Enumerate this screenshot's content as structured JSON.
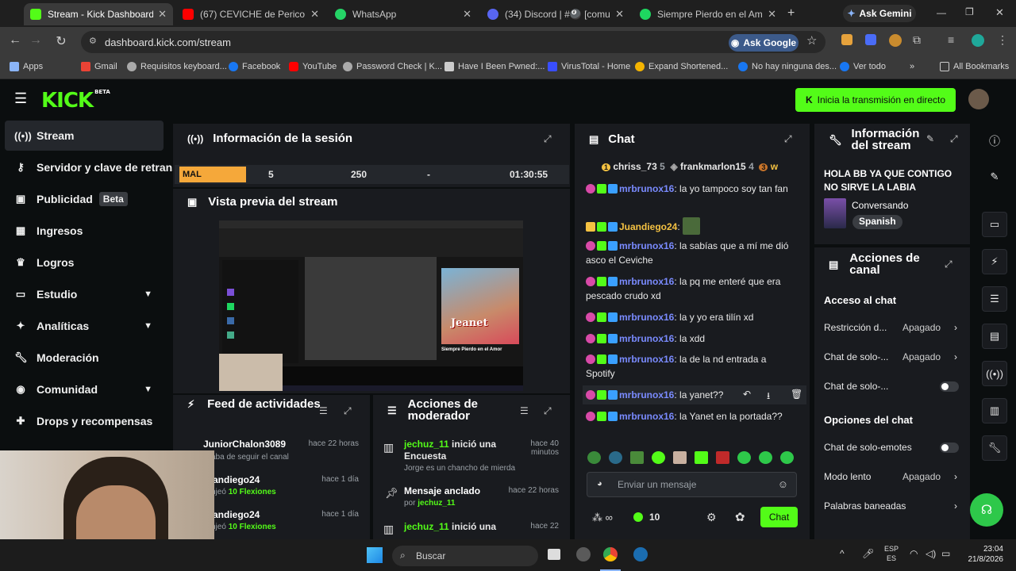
{
  "browser": {
    "tabs": [
      {
        "label": "Stream - Kick Dashboard",
        "active": true,
        "color": "#53fc18"
      },
      {
        "label": "(67) CEVICHE de Perico (Dora…",
        "active": false,
        "color": "#ff0000"
      },
      {
        "label": "WhatsApp",
        "active": false,
        "color": "#25d366"
      },
      {
        "label": "(34) Discord | #🎱 [comunid…",
        "active": false,
        "color": "#5865f2"
      },
      {
        "label": "Siempre Pierdo en el Amor - …",
        "active": false,
        "color": "#1ed760"
      }
    ],
    "ask_gemini": "Ask Gemini",
    "url": "dashboard.kick.com/stream",
    "ask_google": "Ask Google",
    "bookmarks": [
      "Apps",
      "Gmail",
      "Requisitos keyboard...",
      "Facebook",
      "YouTube",
      "Password Check | K...",
      "Have I Been Pwned:...",
      "VirusTotal - Home",
      "Expand Shortened...",
      "No hay ninguna des...",
      "Ver todo"
    ],
    "all_bookmarks": "All Bookmarks"
  },
  "header": {
    "logo": "KICK",
    "logo_badge": "BETA",
    "go_live": "Inicia la transmisión en directo"
  },
  "sidebar": {
    "items": [
      {
        "label": "Stream",
        "icon": "broadcast-icon"
      },
      {
        "label": "Servidor y clave de retransmisión",
        "icon": "key-icon"
      },
      {
        "label": "Publicidad",
        "icon": "ad-icon",
        "badge": "Beta"
      },
      {
        "label": "Ingresos",
        "icon": "dollar-icon"
      },
      {
        "label": "Logros",
        "icon": "trophy-icon"
      },
      {
        "label": "Estudio",
        "icon": "studio-icon"
      },
      {
        "label": "Analíticas",
        "icon": "analytics-icon"
      },
      {
        "label": "Moderación",
        "icon": "wrench-icon"
      },
      {
        "label": "Comunidad",
        "icon": "community-icon"
      },
      {
        "label": "Drops y recompensas",
        "icon": "gift-icon"
      }
    ]
  },
  "session": {
    "title": "Información de la sesión",
    "quality": "MAL",
    "viewers": "5",
    "followers": "250",
    "subs": "-",
    "duration": "01:30:55"
  },
  "preview": {
    "title": "Vista previa del stream",
    "inner_song": "Siempre Pierdo en el Amor",
    "inner_name": "Jeanet"
  },
  "feed": {
    "title": "Feed de actividades",
    "items": [
      {
        "user": "JuniorChalon3089",
        "text": "…aba de seguir el canal",
        "time": "hace 22 horas"
      },
      {
        "user": "…andiego24",
        "text": "…njeó ",
        "highlight": "10 Flexiones",
        "time": "hace 1 día"
      },
      {
        "user": "…andiego24",
        "text": "…njeó ",
        "highlight": "10 Flexiones",
        "time": "hace 1 día"
      }
    ]
  },
  "modactions": {
    "title": "Acciones de moderador",
    "items": [
      {
        "user": "jechuz_11",
        "action": "inició una Encuesta",
        "sub": "Jorge es un chancho de mierda",
        "time": "hace 40 minutos"
      },
      {
        "user": "",
        "action": "Mensaje anclado",
        "sub": "por ",
        "sub_user": "jechuz_11",
        "time": "hace 22 horas"
      },
      {
        "user": "jechuz_11",
        "action": "inició una",
        "sub": "",
        "time": "hace 22"
      }
    ]
  },
  "chat": {
    "title": "Chat",
    "top_gifters": [
      {
        "rank": "1",
        "name": "chriss_73",
        "count": "5"
      },
      {
        "rank": "",
        "name": "frankmarlon15",
        "count": "4"
      },
      {
        "rank": "3",
        "name": "w",
        "count": ""
      }
    ],
    "messages": [
      {
        "user": "mrbrunox16",
        "text": ": la yo tampoco soy tan fan"
      },
      {
        "user": "Juandiego24",
        "text": ":"
      },
      {
        "user": "mrbrunox16",
        "text": ": la sabías que a mí me dió asco el Ceviche"
      },
      {
        "user": "mrbrunox16",
        "text": ": la pq me enteré que era pescado crudo xd"
      },
      {
        "user": "mrbrunox16",
        "text": ": la y yo era tilín xd"
      },
      {
        "user": "mrbrunox16",
        "text": ": la xdd"
      },
      {
        "user": "mrbrunox16",
        "text": ": la de la nd entrada a Spotify"
      },
      {
        "user": "mrbrunox16",
        "text": ": la yanet??"
      },
      {
        "user": "mrbrunox16",
        "text": ": la Yanet en la portada??"
      }
    ],
    "placeholder": "Enviar un mensaje",
    "points": "10",
    "send": "Chat"
  },
  "stream_info": {
    "title": "Información del stream",
    "stream_title": "HOLA BB YA QUE CONTIGO NO SIRVE LA LABIA",
    "category": "Conversando",
    "language": "Spanish"
  },
  "channel_actions": {
    "title": "Acciones de canal",
    "section1": "Acceso al chat",
    "rows1": [
      {
        "label": "Restricción d...",
        "value": "Apagado",
        "kind": "arrow"
      },
      {
        "label": "Chat de solo-...",
        "value": "Apagado",
        "kind": "arrow"
      },
      {
        "label": "Chat de solo-...",
        "value": "",
        "kind": "toggle"
      }
    ],
    "section2": "Opciones del chat",
    "rows2": [
      {
        "label": "Chat de solo-emotes",
        "value": "",
        "kind": "toggle"
      },
      {
        "label": "Modo lento",
        "value": "Apagado",
        "kind": "arrow"
      },
      {
        "label": "Palabras baneadas",
        "value": "",
        "kind": "arrow"
      }
    ]
  },
  "taskbar": {
    "search": "Buscar",
    "lang": "ESP",
    "lang2": "ES",
    "time": "23:04",
    "date": "21/8/2026"
  }
}
